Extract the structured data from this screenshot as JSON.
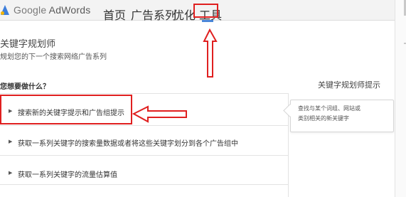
{
  "header": {
    "logo_google": "Google",
    "logo_adwords": " AdWords",
    "nav": [
      {
        "label": "首页"
      },
      {
        "label": "广告系列"
      },
      {
        "label": "优化"
      },
      {
        "label": "工具"
      }
    ]
  },
  "main": {
    "title": "关键字规划师",
    "subtitle": "规划您的下一个搜索网络广告系列",
    "question": "您想要做什么？",
    "options": [
      {
        "label": "搜索新的关键字提示和广告组提示"
      },
      {
        "label": "获取一系列关键字的搜索量数据或者将这些关键字划分到各个广告组中"
      },
      {
        "label": "获取一系列关键字的流量估算值"
      }
    ]
  },
  "sidebar": {
    "title": "关键字规划师提示",
    "tip_lines": [
      "查找与某个词组、网站或",
      "类别相关的新关键字"
    ]
  },
  "annotations": {
    "color": "#e02020"
  }
}
